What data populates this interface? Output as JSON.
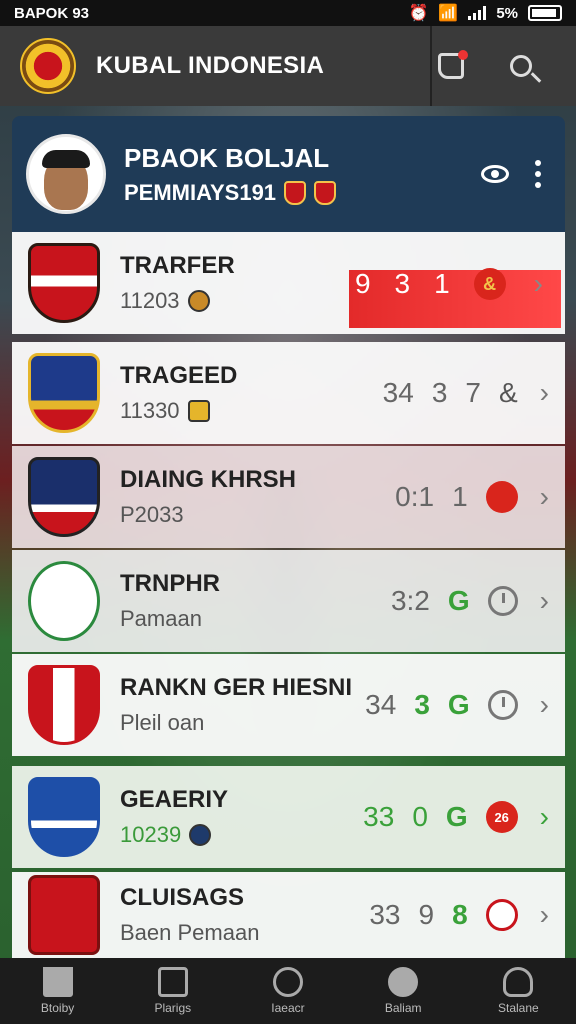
{
  "status_bar": {
    "time": "BAPOK 93",
    "battery": "5%"
  },
  "app_bar": {
    "title": "KUBAL INDONESIA",
    "icons": [
      "notification-icon",
      "search-icon"
    ]
  },
  "profile": {
    "line1": "PBAOK BOLJAL",
    "line2": "PEMMIAYS191",
    "icons": [
      "view-icon",
      "more-icon"
    ]
  },
  "rows": [
    {
      "name": "TRARFER",
      "sub": "11203",
      "stats": [
        "9",
        "3",
        "1"
      ],
      "badge": "&"
    },
    {
      "name": "TRAGEED",
      "sub": "11330",
      "stats": [
        "34",
        "3",
        "7"
      ],
      "badge": "&"
    },
    {
      "name": "DIAING KHRSH",
      "sub": "P2033",
      "stats": [
        "0:1",
        "1"
      ],
      "badge": ""
    },
    {
      "name": "TRNPHR",
      "sub": "Pamaan",
      "stats": [
        "3:2",
        "G"
      ],
      "badge": ""
    },
    {
      "name": "RANKN GER HIESNI",
      "sub": "Pleil oan",
      "stats": [
        "34",
        "3",
        "G"
      ],
      "badge": ""
    },
    {
      "name": "GEAERIY",
      "sub": "10239",
      "stats": [
        "33",
        "0",
        "G"
      ],
      "badge": "26"
    },
    {
      "name": "CLUISAGS",
      "sub": "Baen Pemaan",
      "stats": [
        "33",
        "9",
        "8"
      ],
      "badge": ""
    }
  ],
  "nav": [
    {
      "label": "Btoiby",
      "icon": "home-icon"
    },
    {
      "label": "Plarigs",
      "icon": "search-icon"
    },
    {
      "label": "Iaeacr",
      "icon": "play-icon"
    },
    {
      "label": "Baliam",
      "icon": "ball-icon"
    },
    {
      "label": "Stalane",
      "icon": "user-icon"
    }
  ],
  "colors": {
    "accent_red": "#e32a2a",
    "green": "#3aa13a",
    "header_blue": "#1f3b57"
  }
}
